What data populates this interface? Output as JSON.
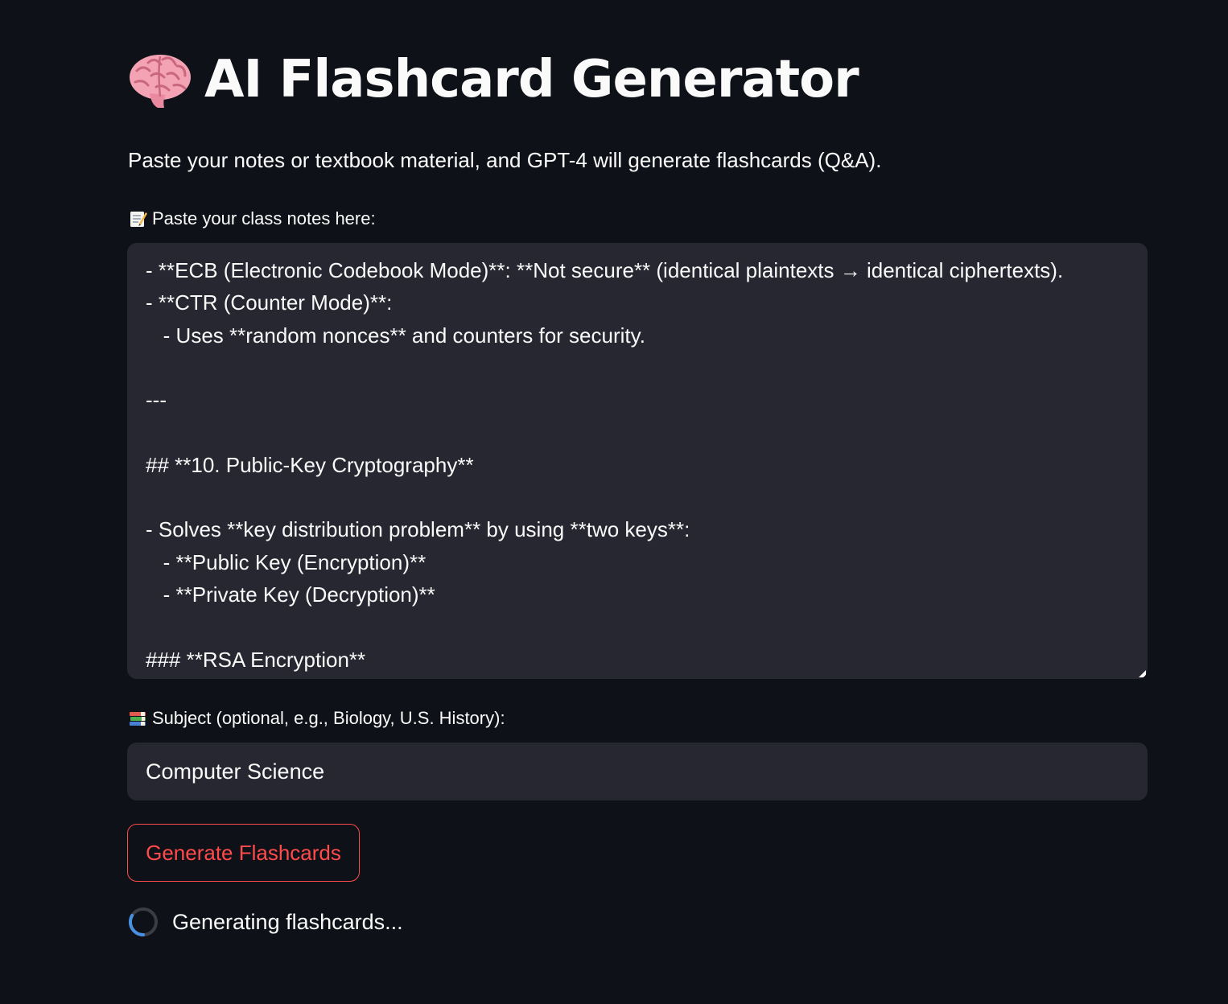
{
  "header": {
    "title_icon": "brain-icon",
    "title": "AI Flashcard Generator",
    "subtitle": "Paste your notes or textbook material, and GPT-4 will generate flashcards (Q&A)."
  },
  "notes": {
    "label_icon": "memo-icon",
    "label": "Paste your class notes here:",
    "value": "- **ECB (Electronic Codebook Mode)**: **Not secure** (identical plaintexts → identical ciphertexts).\n- **CTR (Counter Mode)**:\n   - Uses **random nonces** and counters for security.\n\n---\n\n## **10. Public-Key Cryptography**\n\n- Solves **key distribution problem** by using **two keys**:\n   - **Public Key (Encryption)**\n   - **Private Key (Decryption)**\n\n### **RSA Encryption**"
  },
  "subject": {
    "label_icon": "books-icon",
    "label": "Subject (optional, e.g., Biology, U.S. History):",
    "value": "Computer Science"
  },
  "actions": {
    "generate_label": "Generate Flashcards"
  },
  "status": {
    "spinner_text": "Generating flashcards..."
  },
  "colors": {
    "background": "#0e1117",
    "input_background": "#262730",
    "accent": "#ff4b4b",
    "spinner": "#4a90e2"
  }
}
